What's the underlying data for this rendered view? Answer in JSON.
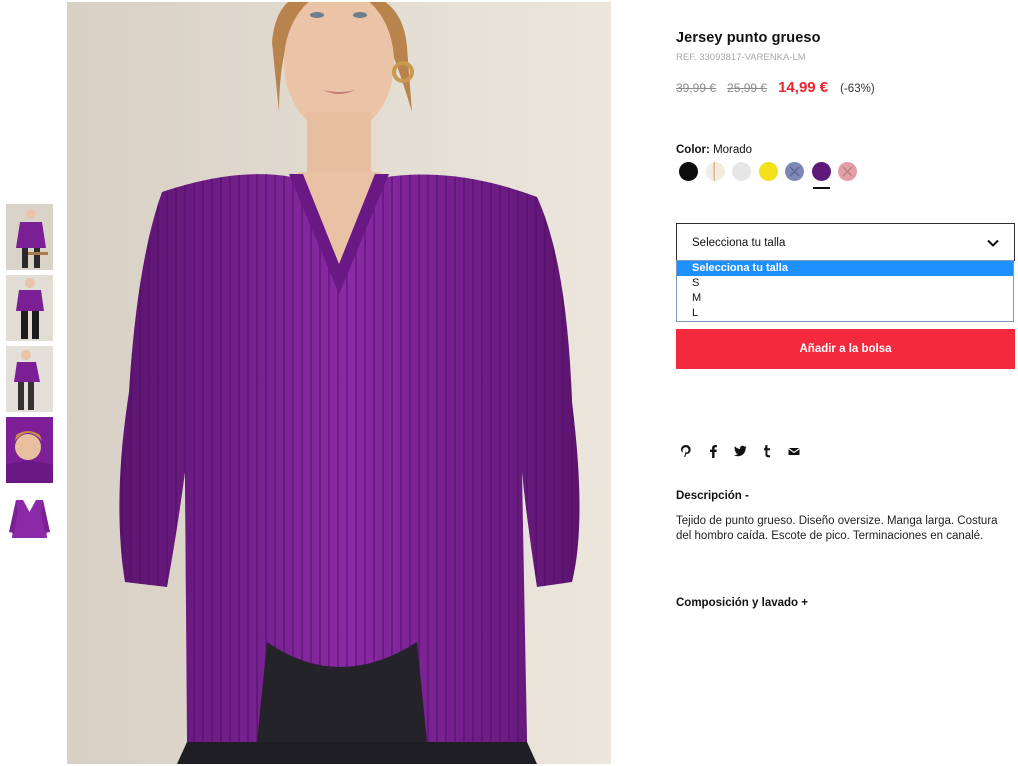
{
  "product": {
    "title": "Jersey punto grueso",
    "ref": "REF. 33093817-VARENKA-LM",
    "prices": {
      "original": "39,99 €",
      "previous": "25,99 €",
      "current": "14,99 €",
      "discount": "(-63%)"
    },
    "color": {
      "label": "Color:",
      "value": "Morado",
      "swatches": [
        {
          "name": "negro",
          "hex": "#0d0d0d"
        },
        {
          "name": "crudo",
          "hex": "#efe5d6"
        },
        {
          "name": "gris claro",
          "hex": "#e6e6e6"
        },
        {
          "name": "amarillo",
          "hex": "#f2e01a"
        },
        {
          "name": "azul",
          "hex": "#7d88b8"
        },
        {
          "name": "morado",
          "hex": "#5e1a7a"
        },
        {
          "name": "rosa",
          "hex": "#e0a0a6"
        }
      ],
      "selected_index": 5
    },
    "size": {
      "label": "Selecciona tu talla",
      "options": [
        "Selecciona tu talla",
        "S",
        "M",
        "L"
      ],
      "highlighted_index": 0
    },
    "add_to_bag": "Añadir a la bolsa",
    "share_icons": [
      "pinterest-icon",
      "facebook-icon",
      "twitter-icon",
      "tumblr-icon",
      "email-icon"
    ],
    "description": {
      "title": "Descripción -",
      "text": "Tejido de punto grueso. Diseño oversize. Manga larga. Costura del hombro caída. Escote de pico. Terminaciones en canalé."
    },
    "composition": {
      "title": "Composición y lavado +"
    }
  },
  "gallery": {
    "thumbnail_count": 5,
    "accent_color": "#7d1f96"
  }
}
